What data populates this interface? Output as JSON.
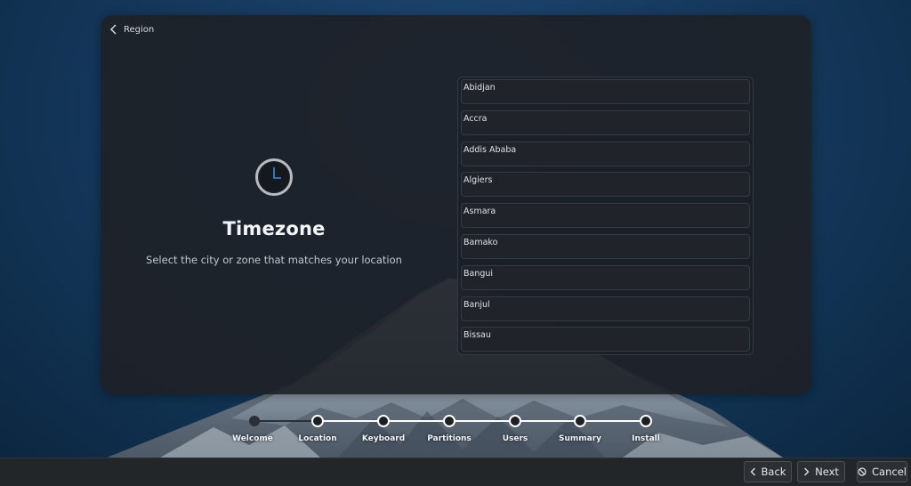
{
  "header": {
    "back_label": "Region"
  },
  "main": {
    "title": "Timezone",
    "subtitle": "Select the city or zone that matches your location",
    "cities": [
      "Abidjan",
      "Accra",
      "Addis Ababa",
      "Algiers",
      "Asmara",
      "Bamako",
      "Bangui",
      "Banjul",
      "Bissau"
    ]
  },
  "steps": [
    {
      "label": "Welcome",
      "state": "done"
    },
    {
      "label": "Location",
      "state": "current"
    },
    {
      "label": "Keyboard",
      "state": "todo"
    },
    {
      "label": "Partitions",
      "state": "todo"
    },
    {
      "label": "Users",
      "state": "todo"
    },
    {
      "label": "Summary",
      "state": "todo"
    },
    {
      "label": "Install",
      "state": "todo"
    }
  ],
  "bottom_bar": {
    "back_label": "Back",
    "next_label": "Next",
    "cancel_label": "Cancel"
  },
  "colors": {
    "accent": "#3d8de0",
    "card_bg": "#1e2128",
    "bar_bg": "#232629"
  },
  "icons": {
    "back": "chevron-left-icon",
    "timezone": "clock-icon",
    "next": "chevron-right-icon",
    "cancel": "cancel-icon"
  }
}
